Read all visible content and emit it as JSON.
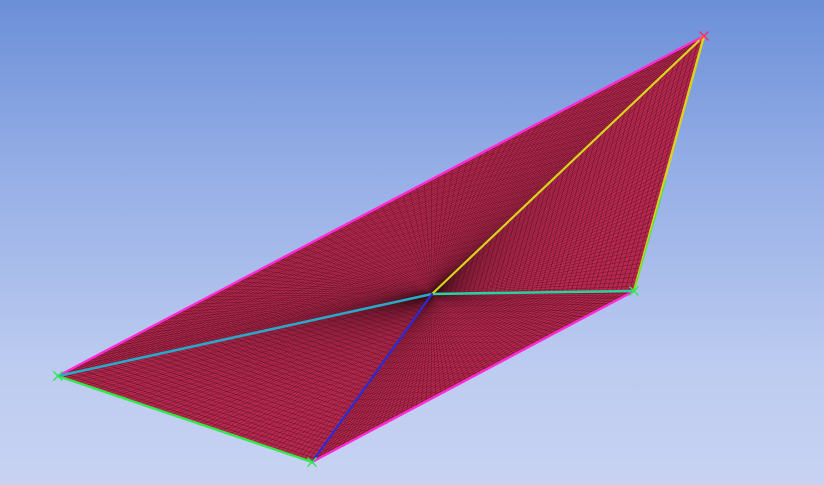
{
  "viewport": {
    "background_top": "#6b8fd8",
    "background_bottom": "#c8d3f2"
  },
  "mesh": {
    "face_color": "#b8284f",
    "mesh_line_color": "#3a0c18",
    "edge_colors": {
      "outer_boundary": "#ff2ad4",
      "left_bottom_edge": "#33e84a",
      "center_to_left": "#2aa8c8",
      "center_to_right": "#2ad0a0",
      "center_to_top": "#d8d41c",
      "top_to_right": "#d8d41c",
      "center_to_bottom": "#2a2ad8"
    },
    "vertex_marker_color": "#33e84a",
    "top_vertex_marker_color": "#ff2a6a"
  }
}
